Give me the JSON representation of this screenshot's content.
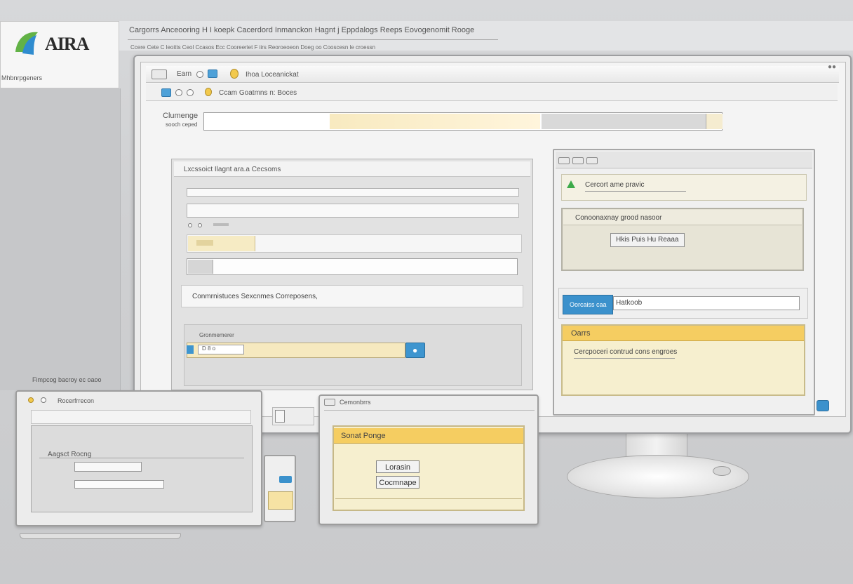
{
  "brand": {
    "logo_text": "AIRA",
    "logo_tagline": "Mhbnrpgeners"
  },
  "background_app": {
    "menu_row": "Cargorrs  Anceooring  H I koepk  Cacerdord Inmanckon  Hagnt j  Eppdalogs  Reeps  Eovogenomit  Rooge",
    "sub_row": "Ccere Cete  C leoitts  Ceol  Ccasos  Ecc  Cooreeriet  F iirs  Reoroeoeon  Doeg  oo  Cooscesn  le  croessn",
    "side_caption": "Fimpcog  bacroy  ec  oaoo"
  },
  "browser": {
    "tab_label": "Earn",
    "page_title": "Ihoa  Loceanickat",
    "toolbar_title": "Ccam  Goatmns  n:  Boces"
  },
  "search": {
    "label": "Clumenge",
    "sublabel": "sooch ceped"
  },
  "left_panel": {
    "header": "Lxcssoict Ilagnt ara.a  Cecsoms",
    "summary": "Conmrnistuces  Sexcnmes  Correposens,",
    "sub_label": "Gronmemerer",
    "sub_field_value": "D 8 o"
  },
  "right_panel": {
    "alert_text": "Cercort  ame  pravic",
    "box_title": "Conoonaxnay  grood  nasoor",
    "box_button": "Hkis  Puis Hu  Reaaa",
    "blue_button": "Oorcaiss  caa",
    "input_value": "Hatkoob",
    "yellow_title": "Oarrs",
    "yellow_text": "Cercpoceri  contrud  cons  engroes"
  },
  "laptop": {
    "title": "Rocerfrrecon",
    "field_label": "Aagsct  Rocng"
  },
  "tablet": {
    "title": "Cemonbrrs",
    "panel_title": "Sonat  Ponge",
    "button1": "Lorasin",
    "button2": "Cocmnape"
  },
  "colors": {
    "accent_blue": "#3b91cc",
    "accent_yellow": "#f5cd61",
    "panel_yellow": "#f6efcf"
  }
}
